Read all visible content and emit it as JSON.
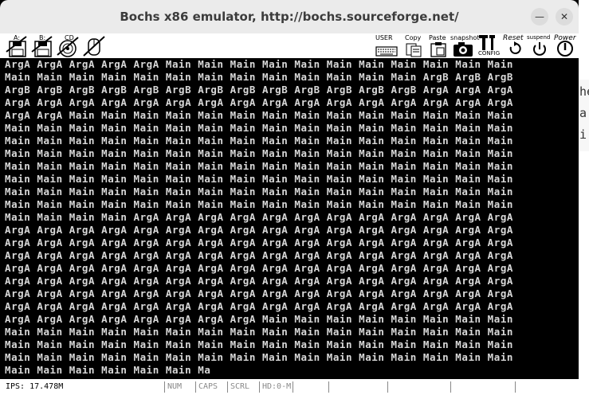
{
  "window": {
    "title": "Bochs x86 emulator, http://bochs.sourceforge.net/"
  },
  "toolbar": {
    "floppy_a_label": "A:",
    "floppy_b_label": "B:",
    "cdrom_label": "CD",
    "user_label": "USER",
    "copy_label": "Copy",
    "paste_label": "Paste",
    "snapshot_label": "snapshot",
    "config_label": "CONFIG",
    "reset_label": "Reset",
    "suspend_label": "suspend",
    "power_label": "Power"
  },
  "screen": {
    "lines": [
      "ArgA ArgA ArgA ArgA ArgA Main Main Main Main Main Main Main Main Main Main Main",
      "Main Main Main Main Main Main Main Main Main Main Main Main Main ArgB ArgB ArgB",
      "ArgB ArgB ArgB ArgB ArgB ArgB ArgB ArgB ArgB ArgB ArgB ArgB ArgB ArgA ArgA ArgA",
      "ArgA ArgA ArgA ArgA ArgA ArgA ArgA ArgA ArgA ArgA ArgA ArgA ArgA ArgA ArgA ArgA",
      "ArgA ArgA Main Main Main Main Main Main Main Main Main Main Main Main Main Main",
      "Main Main Main Main Main Main Main Main Main Main Main Main Main Main Main Main",
      "Main Main Main Main Main Main Main Main Main Main Main Main Main Main Main Main",
      "Main Main Main Main Main Main Main Main Main Main Main Main Main Main Main Main",
      "Main Main Main Main Main Main Main Main Main Main Main Main Main Main Main Main",
      "Main Main Main Main Main Main Main Main Main Main Main Main Main Main Main Main",
      "Main Main Main Main Main Main Main Main Main Main Main Main Main Main Main Main",
      "Main Main Main Main Main Main Main Main Main Main Main Main Main Main Main Main",
      "Main Main Main Main ArgA ArgA ArgA ArgA ArgA ArgA ArgA ArgA ArgA ArgA ArgA ArgA",
      "ArgA ArgA ArgA ArgA ArgA ArgA ArgA ArgA ArgA ArgA ArgA ArgA ArgA ArgA ArgA ArgA",
      "ArgA ArgA ArgA ArgA ArgA ArgA ArgA ArgA ArgA ArgA ArgA ArgA ArgA ArgA ArgA ArgA",
      "ArgA ArgA ArgA ArgA ArgA ArgA ArgA ArgA ArgA ArgA ArgA ArgA ArgA ArgA ArgA ArgA",
      "ArgA ArgA ArgA ArgA ArgA ArgA ArgA ArgA ArgA ArgA ArgA ArgA ArgA ArgA ArgA ArgA",
      "ArgA ArgA ArgA ArgA ArgA ArgA ArgA ArgA ArgA ArgA ArgA ArgA ArgA ArgA ArgA ArgA",
      "ArgA ArgA ArgA ArgA ArgA ArgA ArgA ArgA ArgA ArgA ArgA ArgA ArgA ArgA ArgA ArgA",
      "ArgA ArgA ArgA ArgA ArgA ArgA ArgA ArgA ArgA ArgA ArgA ArgA ArgA ArgA ArgA ArgA",
      "ArgA ArgA ArgA ArgA ArgA ArgA ArgA ArgA Main Main Main Main Main Main Main Main",
      "Main Main Main Main Main Main Main Main Main Main Main Main Main Main Main Main",
      "Main Main Main Main Main Main Main Main Main Main Main Main Main Main Main Main",
      "Main Main Main Main Main Main Main Main Main Main Main Main Main Main Main Main",
      "Main Main Main Main Main Main Ma"
    ]
  },
  "status": {
    "ips": "IPS: 17.478M",
    "num": "NUM",
    "caps": "CAPS",
    "scrl": "SCRL",
    "hd": "HD:0-M"
  },
  "desktop_fragment": [
    "he",
    "a",
    "i"
  ]
}
